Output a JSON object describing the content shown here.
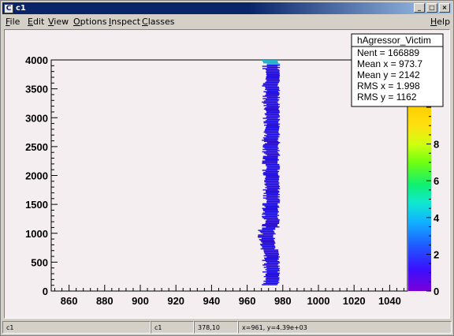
{
  "window": {
    "title": "c1",
    "app_icon_glyph": "C",
    "buttons": {
      "minimize": "_",
      "maximize": "□",
      "close": "×"
    }
  },
  "menu": {
    "items": [
      {
        "label": "File",
        "underline": "F",
        "rest": "ile"
      },
      {
        "label": "Edit",
        "underline": "E",
        "rest": "dit"
      },
      {
        "label": "View",
        "underline": "V",
        "rest": "iew"
      },
      {
        "label": "Options",
        "underline": "O",
        "rest": "ptions"
      },
      {
        "label": "Inspect",
        "underline": "I",
        "rest": "nspect"
      },
      {
        "label": "Classes",
        "underline": "C",
        "rest": "lasses"
      }
    ],
    "help": {
      "label": "Help",
      "underline": "H",
      "rest": "elp"
    }
  },
  "statusbar": {
    "cells": [
      "c1",
      "c1",
      "378,10",
      "x=961, y=4.39e+03"
    ]
  },
  "chart_data": {
    "type": "heatmap",
    "title": "",
    "xlabel": "",
    "ylabel": "",
    "xlim": [
      850,
      1050
    ],
    "ylim": [
      0,
      4000
    ],
    "xticks": [
      "860",
      "880",
      "900",
      "920",
      "940",
      "960",
      "980",
      "1000",
      "1020",
      "1040"
    ],
    "xtick_values": [
      860,
      880,
      900,
      920,
      940,
      960,
      980,
      1000,
      1020,
      1040
    ],
    "yticks": [
      "0",
      "500",
      "1000",
      "1500",
      "2000",
      "2500",
      "3000",
      "3500",
      "4000"
    ],
    "ytick_values": [
      0,
      500,
      1000,
      1500,
      2000,
      2500,
      3000,
      3500,
      4000
    ],
    "zticks": [
      "0",
      "2",
      "4",
      "6",
      "8",
      "10"
    ],
    "ztick_values": [
      0,
      2,
      4,
      6,
      8,
      10
    ],
    "zlim": [
      0,
      10
    ],
    "band": {
      "x_min": 967,
      "x_max": 980,
      "x_center": 973.7,
      "y_min": 100,
      "y_max": 4000
    },
    "stats": {
      "name": "hAgressor_Victim",
      "lines": [
        {
          "label": "Nent = ",
          "value": "166889"
        },
        {
          "label": "Mean x = ",
          "value": "973.7"
        },
        {
          "label": "Mean y = ",
          "value": "2142"
        },
        {
          "label": "RMS x = ",
          "value": "1.998"
        },
        {
          "label": "RMS y = ",
          "value": "1162"
        }
      ]
    },
    "colors": {
      "band": "#1e10e8",
      "band_dark": "#2b0fd0",
      "band_top": "#1fb2c8",
      "frame_bg": "#f4eef0"
    }
  }
}
